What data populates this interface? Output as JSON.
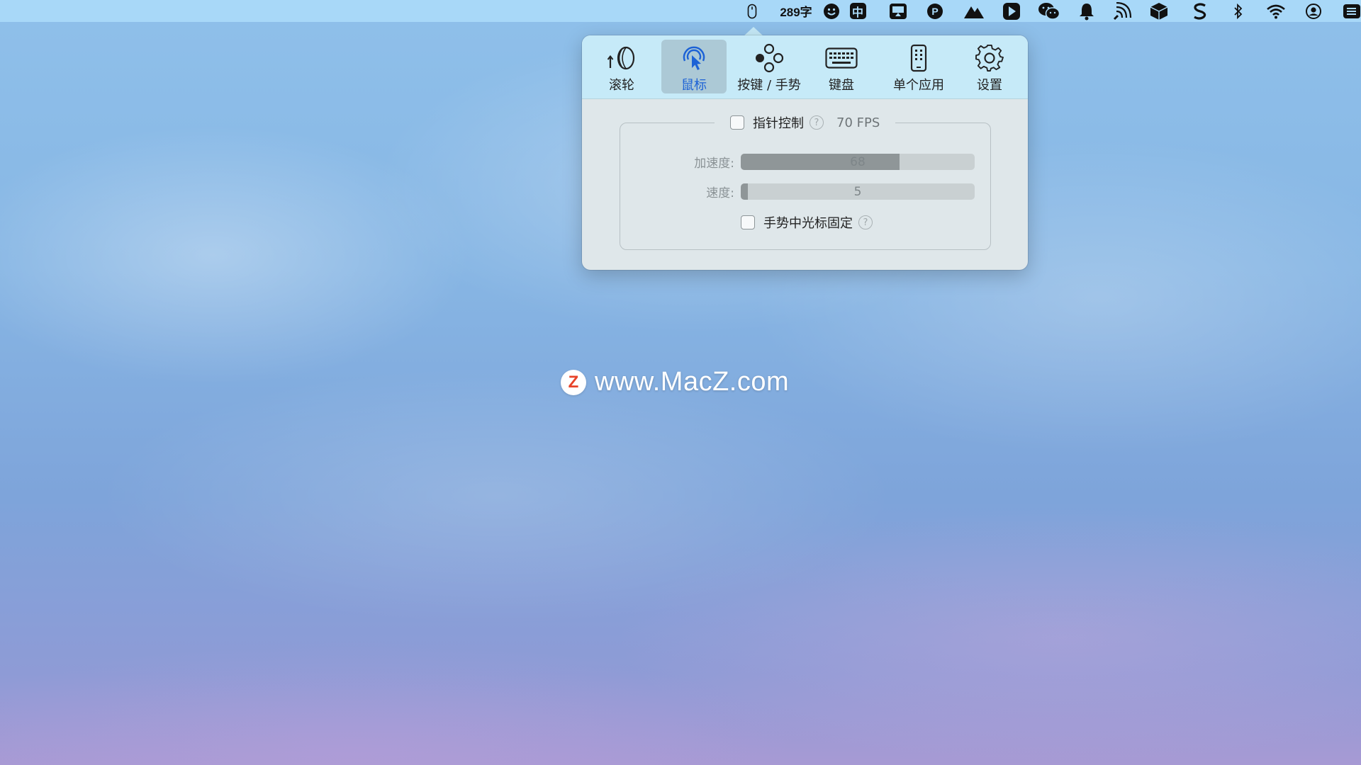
{
  "menubar": {
    "word_count": "289字",
    "input_method": "中",
    "icons": [
      "mouse-icon",
      "emoji-icon",
      "input-method-icon",
      "screen-share-icon",
      "p-circle-icon",
      "mountain-icon",
      "play-tag-icon",
      "wechat-icon",
      "bell-icon",
      "signal-icon",
      "cube-icon",
      "s-brand-icon",
      "bluetooth-icon",
      "wifi-icon",
      "user-circle-icon",
      "sidebar-icon"
    ]
  },
  "popover": {
    "tabs": [
      {
        "label": "滚轮",
        "icon": "scroll-wheel-icon"
      },
      {
        "label": "鼠标",
        "icon": "pointer-icon",
        "active": true
      },
      {
        "label": "按键 / 手势",
        "icon": "buttons-gesture-icon"
      },
      {
        "label": "键盘",
        "icon": "keyboard-icon"
      },
      {
        "label": "单个应用",
        "icon": "single-app-icon"
      },
      {
        "label": "设置",
        "icon": "gear-icon"
      }
    ],
    "pointer": {
      "label": "指针控制",
      "checked": false,
      "fps": "70 FPS",
      "acceleration": {
        "label": "加速度:",
        "value": "68",
        "fraction": 0.68
      },
      "speed": {
        "label": "速度:",
        "value": "5",
        "fraction": 0.03
      },
      "lock_cursor": {
        "label": "手势中光标固定",
        "checked": false
      }
    },
    "help_glyph": "?"
  },
  "watermark": {
    "logo_letter": "Z",
    "text": "www.MacZ.com"
  },
  "colors": {
    "accent": "#1d62d6",
    "toolbar_bg": "#c6eaf8",
    "popover_bg": "#dfe7ea",
    "watermark_logo": "#e8442a"
  }
}
